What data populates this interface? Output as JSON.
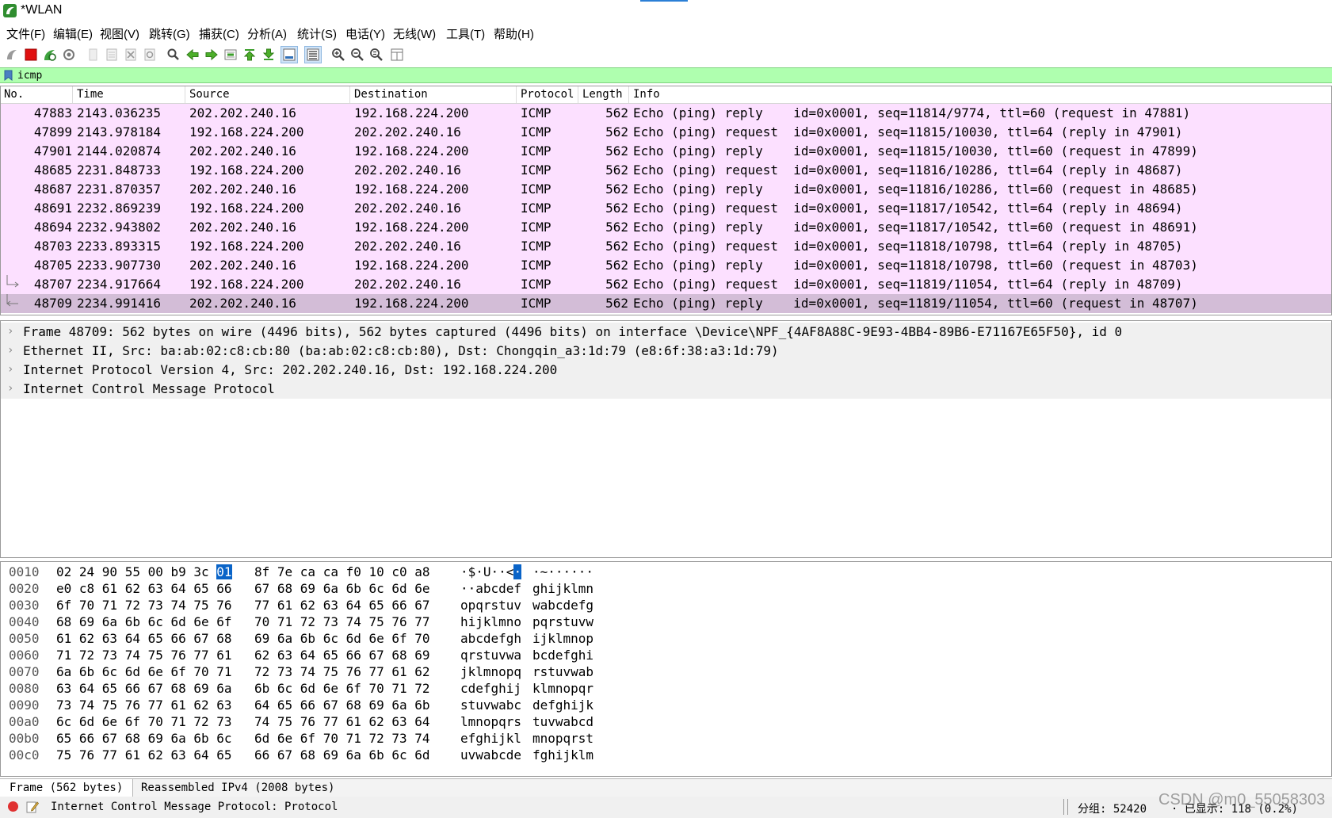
{
  "window": {
    "title": "*WLAN"
  },
  "menu": [
    {
      "label": "文件(F)"
    },
    {
      "label": "编辑(E)"
    },
    {
      "label": "视图(V)"
    },
    {
      "label": "跳转(G)"
    },
    {
      "label": "捕获(C)"
    },
    {
      "label": "分析(A)"
    },
    {
      "label": "统计(S)"
    },
    {
      "label": "电话(Y)"
    },
    {
      "label": "无线(W)"
    },
    {
      "label": "工具(T)"
    },
    {
      "label": "帮助(H)"
    }
  ],
  "toolbar": {
    "icons": [
      "start-capture-icon",
      "stop-capture-icon",
      "restart-capture-icon",
      "capture-options-icon",
      "open-file-icon",
      "save-file-icon",
      "close-file-icon",
      "reload-file-icon",
      "find-packet-icon",
      "go-back-icon",
      "go-forward-icon",
      "go-to-packet-icon",
      "first-packet-icon",
      "last-packet-icon",
      "auto-scroll-icon",
      "colorize-icon",
      "zoom-in-icon",
      "zoom-out-icon",
      "zoom-normal-icon",
      "resize-columns-icon"
    ]
  },
  "filter": {
    "value": "icmp"
  },
  "packet_list": {
    "columns": [
      "No.",
      "Time",
      "Source",
      "Destination",
      "Protocol",
      "Length",
      "Info"
    ],
    "rows": [
      {
        "no": "47883",
        "time": "2143.036235",
        "src": "202.202.240.16",
        "dst": "192.168.224.200",
        "proto": "ICMP",
        "len": "562",
        "info": "Echo (ping) reply    id=0x0001, seq=11814/9774, ttl=60 (request in 47881)"
      },
      {
        "no": "47899",
        "time": "2143.978184",
        "src": "192.168.224.200",
        "dst": "202.202.240.16",
        "proto": "ICMP",
        "len": "562",
        "info": "Echo (ping) request  id=0x0001, seq=11815/10030, ttl=64 (reply in 47901)"
      },
      {
        "no": "47901",
        "time": "2144.020874",
        "src": "202.202.240.16",
        "dst": "192.168.224.200",
        "proto": "ICMP",
        "len": "562",
        "info": "Echo (ping) reply    id=0x0001, seq=11815/10030, ttl=60 (request in 47899)"
      },
      {
        "no": "48685",
        "time": "2231.848733",
        "src": "192.168.224.200",
        "dst": "202.202.240.16",
        "proto": "ICMP",
        "len": "562",
        "info": "Echo (ping) request  id=0x0001, seq=11816/10286, ttl=64 (reply in 48687)"
      },
      {
        "no": "48687",
        "time": "2231.870357",
        "src": "202.202.240.16",
        "dst": "192.168.224.200",
        "proto": "ICMP",
        "len": "562",
        "info": "Echo (ping) reply    id=0x0001, seq=11816/10286, ttl=60 (request in 48685)"
      },
      {
        "no": "48691",
        "time": "2232.869239",
        "src": "192.168.224.200",
        "dst": "202.202.240.16",
        "proto": "ICMP",
        "len": "562",
        "info": "Echo (ping) request  id=0x0001, seq=11817/10542, ttl=64 (reply in 48694)"
      },
      {
        "no": "48694",
        "time": "2232.943802",
        "src": "202.202.240.16",
        "dst": "192.168.224.200",
        "proto": "ICMP",
        "len": "562",
        "info": "Echo (ping) reply    id=0x0001, seq=11817/10542, ttl=60 (request in 48691)"
      },
      {
        "no": "48703",
        "time": "2233.893315",
        "src": "192.168.224.200",
        "dst": "202.202.240.16",
        "proto": "ICMP",
        "len": "562",
        "info": "Echo (ping) request  id=0x0001, seq=11818/10798, ttl=64 (reply in 48705)"
      },
      {
        "no": "48705",
        "time": "2233.907730",
        "src": "202.202.240.16",
        "dst": "192.168.224.200",
        "proto": "ICMP",
        "len": "562",
        "info": "Echo (ping) reply    id=0x0001, seq=11818/10798, ttl=60 (request in 48703)"
      },
      {
        "no": "48707",
        "time": "2234.917664",
        "src": "192.168.224.200",
        "dst": "202.202.240.16",
        "proto": "ICMP",
        "len": "562",
        "info": "Echo (ping) request  id=0x0001, seq=11819/11054, ttl=64 (reply in 48709)"
      },
      {
        "no": "48709",
        "time": "2234.991416",
        "src": "202.202.240.16",
        "dst": "192.168.224.200",
        "proto": "ICMP",
        "len": "562",
        "info": "Echo (ping) reply    id=0x0001, seq=11819/11054, ttl=60 (request in 48707)"
      }
    ],
    "selected_index": 10,
    "row_color": "#fce0ff",
    "selected_color": "#d3bdd7"
  },
  "details": [
    "Frame 48709: 562 bytes on wire (4496 bits), 562 bytes captured (4496 bits) on interface \\Device\\NPF_{4AF8A88C-9E93-4BB4-89B6-E71167E65F50}, id 0",
    "Ethernet II, Src: ba:ab:02:c8:cb:80 (ba:ab:02:c8:cb:80), Dst: Chongqin_a3:1d:79 (e8:6f:38:a3:1d:79)",
    "Internet Protocol Version 4, Src: 202.202.240.16, Dst: 192.168.224.200",
    "Internet Control Message Protocol"
  ],
  "bytes": [
    {
      "off": "0010",
      "h1": "02 24 90 55 00 b9 3c ",
      "hl": "01",
      "h2": "8f 7e ca ca f0 10 c0 a8",
      "a1": "·$·U··<",
      "ahl": "·",
      "a2": "·~······"
    },
    {
      "off": "0020",
      "h1": "e0 c8 61 62 63 64 65 66",
      "hl": "",
      "h2": "67 68 69 6a 6b 6c 6d 6e",
      "a1": "··abcdef",
      "ahl": "",
      "a2": "ghijklmn"
    },
    {
      "off": "0030",
      "h1": "6f 70 71 72 73 74 75 76",
      "hl": "",
      "h2": "77 61 62 63 64 65 66 67",
      "a1": "opqrstuv",
      "ahl": "",
      "a2": "wabcdefg"
    },
    {
      "off": "0040",
      "h1": "68 69 6a 6b 6c 6d 6e 6f",
      "hl": "",
      "h2": "70 71 72 73 74 75 76 77",
      "a1": "hijklmno",
      "ahl": "",
      "a2": "pqrstuvw"
    },
    {
      "off": "0050",
      "h1": "61 62 63 64 65 66 67 68",
      "hl": "",
      "h2": "69 6a 6b 6c 6d 6e 6f 70",
      "a1": "abcdefgh",
      "ahl": "",
      "a2": "ijklmnop"
    },
    {
      "off": "0060",
      "h1": "71 72 73 74 75 76 77 61",
      "hl": "",
      "h2": "62 63 64 65 66 67 68 69",
      "a1": "qrstuvwa",
      "ahl": "",
      "a2": "bcdefghi"
    },
    {
      "off": "0070",
      "h1": "6a 6b 6c 6d 6e 6f 70 71",
      "hl": "",
      "h2": "72 73 74 75 76 77 61 62",
      "a1": "jklmnopq",
      "ahl": "",
      "a2": "rstuvwab"
    },
    {
      "off": "0080",
      "h1": "63 64 65 66 67 68 69 6a",
      "hl": "",
      "h2": "6b 6c 6d 6e 6f 70 71 72",
      "a1": "cdefghij",
      "ahl": "",
      "a2": "klmnopqr"
    },
    {
      "off": "0090",
      "h1": "73 74 75 76 77 61 62 63",
      "hl": "",
      "h2": "64 65 66 67 68 69 6a 6b",
      "a1": "stuvwabc",
      "ahl": "",
      "a2": "defghijk"
    },
    {
      "off": "00a0",
      "h1": "6c 6d 6e 6f 70 71 72 73",
      "hl": "",
      "h2": "74 75 76 77 61 62 63 64",
      "a1": "lmnopqrs",
      "ahl": "",
      "a2": "tuvwabcd"
    },
    {
      "off": "00b0",
      "h1": "65 66 67 68 69 6a 6b 6c",
      "hl": "",
      "h2": "6d 6e 6f 70 71 72 73 74",
      "a1": "efghijkl",
      "ahl": "",
      "a2": "mnopqrst"
    },
    {
      "off": "00c0",
      "h1": "75 76 77 61 62 63 64 65",
      "hl": "",
      "h2": "66 67 68 69 6a 6b 6c 6d",
      "a1": "uvwabcde",
      "ahl": "",
      "a2": "fghijklm"
    }
  ],
  "bottom_tabs": [
    "Frame (562 bytes)",
    "Reassembled IPv4 (2008 bytes)"
  ],
  "status": {
    "message": "Internet Control Message Protocol: Protocol",
    "packets": "分组: 52420",
    "displayed": "· 已显示: 118 (0.2%)"
  },
  "watermark": "CSDN @m0_55058303",
  "colors": {
    "filter_bg": "#afffaf",
    "selection": "#0a64c8"
  }
}
